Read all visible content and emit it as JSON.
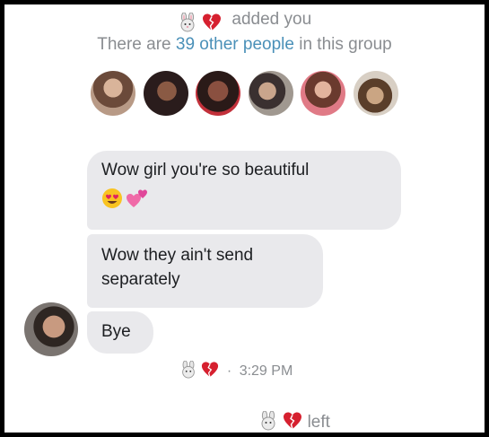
{
  "header": {
    "added_text": "added you",
    "group_prefix": "There are ",
    "group_link": "39 other people",
    "group_suffix": " in this group",
    "emojis": [
      "bunny-face-icon",
      "broken-heart-icon"
    ]
  },
  "group_avatars": [
    {
      "name": "member-avatar-1",
      "tone": "#7a5a48"
    },
    {
      "name": "member-avatar-2",
      "tone": "#3b2a2a"
    },
    {
      "name": "member-avatar-3",
      "tone": "#a0433c"
    },
    {
      "name": "member-avatar-4",
      "tone": "#5e5550"
    },
    {
      "name": "member-avatar-5",
      "tone": "#b56a55"
    },
    {
      "name": "member-avatar-6",
      "tone": "#8a6a4a"
    }
  ],
  "messages": [
    {
      "text": "Wow girl you're so beautiful",
      "emojis": [
        "heart-eyes-icon",
        "two-hearts-icon"
      ]
    },
    {
      "text": "Wow they ain't send separately"
    },
    {
      "text": "Bye"
    }
  ],
  "read_receipt": {
    "separator": "·",
    "time": "3:29 PM"
  },
  "footer": {
    "left_text": "left"
  },
  "colors": {
    "bubble": "#e9e9ec",
    "meta_text": "#8a8d91",
    "link": "#4a90b8",
    "heart": "#e0245e"
  }
}
